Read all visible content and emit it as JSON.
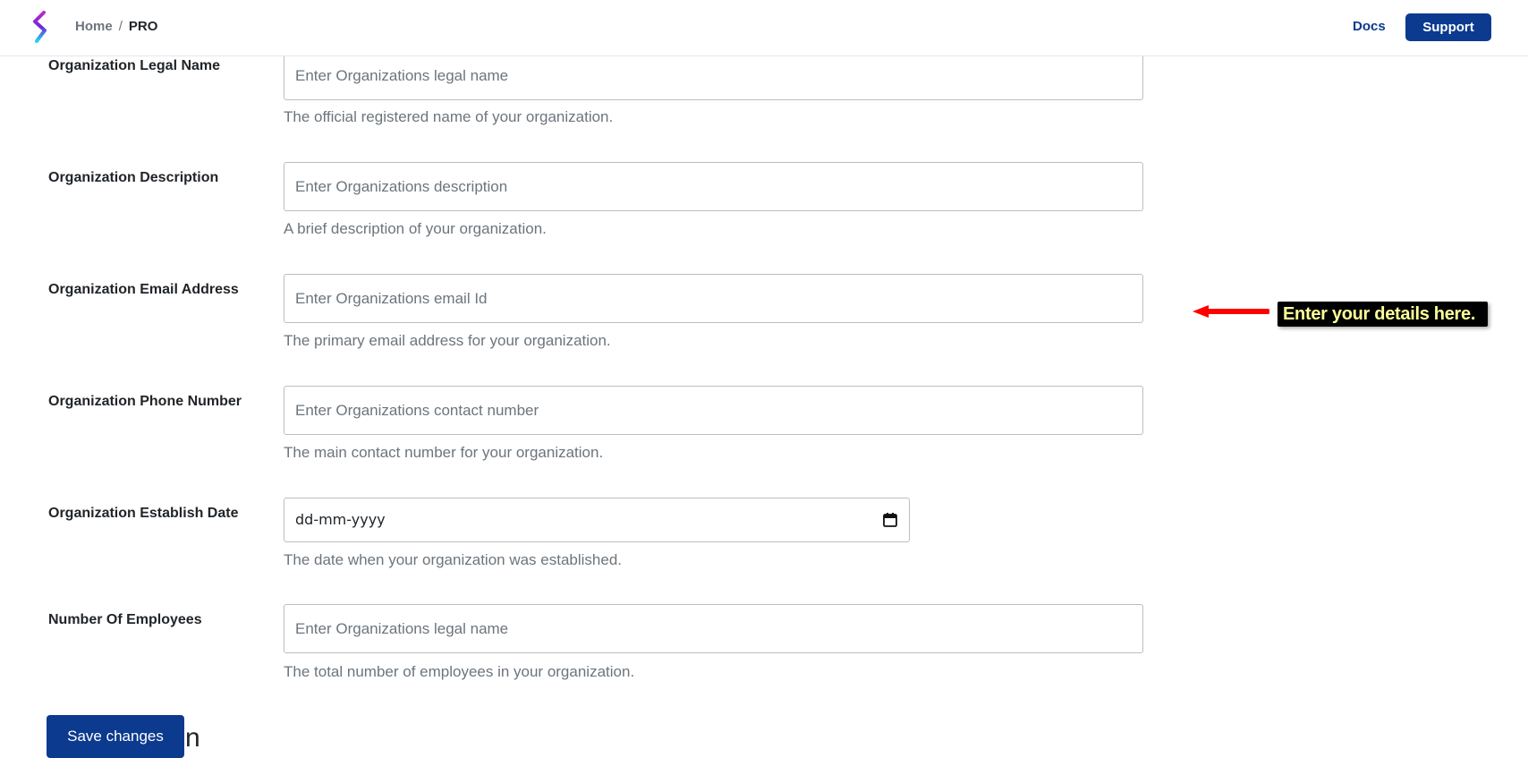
{
  "header": {
    "breadcrumb": {
      "home": "Home",
      "separator": "/",
      "current": "PRO"
    },
    "docs_label": "Docs",
    "support_label": "Support",
    "logo_icon": "brand-s-logo-icon"
  },
  "form": {
    "fields": [
      {
        "label": "Organization Legal Name",
        "placeholder": "Enter Organizations legal name",
        "help": "The official registered name of your organization."
      },
      {
        "label": "Organization Description",
        "placeholder": "Enter Organizations description",
        "help": "A brief description of your organization."
      },
      {
        "label": "Organization Email Address",
        "placeholder": "Enter Organizations email Id",
        "help": "The primary email address for your organization."
      },
      {
        "label": "Organization Phone Number",
        "placeholder": "Enter Organizations contact number",
        "help": "The main contact number for your organization."
      },
      {
        "label": "Organization Establish Date",
        "value": "dd-mm-yyyy",
        "help": "The date when your organization was established."
      },
      {
        "label": "Number Of Employees",
        "placeholder": "Enter Organizations legal name",
        "help": "The total number of employees in your organization."
      }
    ],
    "save_label": "Save changes",
    "trailing_text": "n"
  },
  "annotation": {
    "text": "Enter your details here."
  },
  "colors": {
    "primary": "#0b3a8f",
    "arrow": "#ff0000",
    "tip_bg": "#000000",
    "tip_text": "#ffff99"
  }
}
